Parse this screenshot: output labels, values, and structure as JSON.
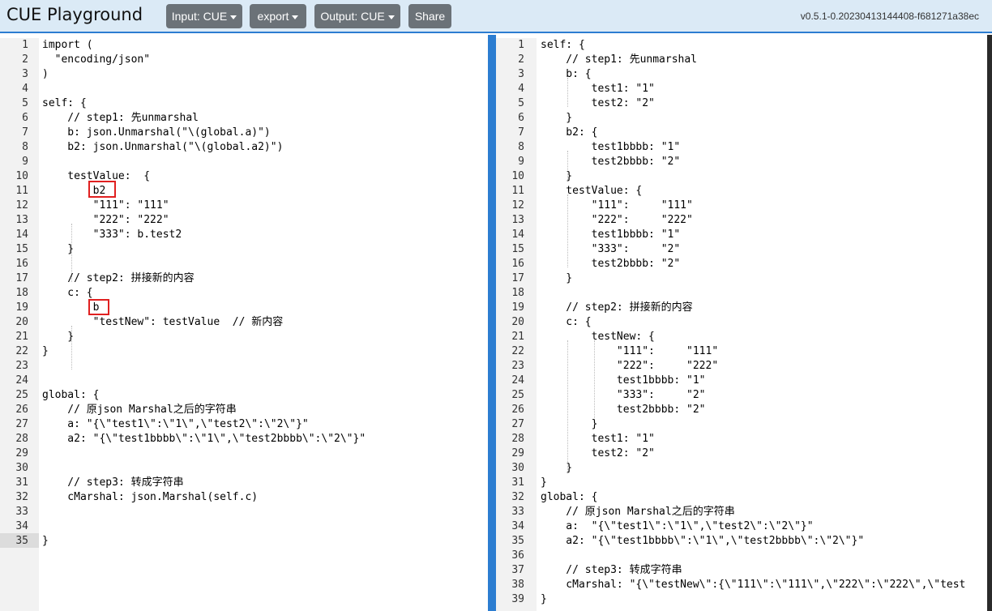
{
  "header": {
    "title": "CUE Playground",
    "input_label": "Input: CUE",
    "export_label": "export",
    "output_label": "Output: CUE",
    "share_label": "Share",
    "version": "v0.5.1-0.20230413144408-f681271a38ec"
  },
  "colors": {
    "accent": "#2c7dd1",
    "header_bg": "#dbeaf6",
    "button_bg": "#6b7278",
    "highlight_box": "#e02020"
  },
  "input": {
    "lines": [
      "import (",
      "  \"encoding/json\"",
      ")",
      "",
      "self: {",
      "    // step1: 先unmarshal",
      "    b: json.Unmarshal(\"\\(global.a)\")",
      "    b2: json.Unmarshal(\"\\(global.a2)\")",
      "",
      "    testValue:  {",
      "        b2",
      "        \"111\": \"111\"",
      "        \"222\": \"222\"",
      "        \"333\": b.test2",
      "    }",
      "",
      "    // step2: 拼接新的内容",
      "    c: {",
      "        b",
      "        \"testNew\": testValue  // 新内容",
      "    }",
      "}",
      "",
      "",
      "global: {",
      "    // 原json Marshal之后的字符串",
      "    a: \"{\\\"test1\\\":\\\"1\\\",\\\"test2\\\":\\\"2\\\"}\"",
      "    a2: \"{\\\"test1bbbb\\\":\\\"1\\\",\\\"test2bbbb\\\":\\\"2\\\"}\"",
      "",
      "",
      "    // step3: 转成字符串",
      "    cMarshal: json.Marshal(self.c)",
      "",
      "",
      "}"
    ]
  },
  "output": {
    "lines": [
      "self: {",
      "    // step1: 先unmarshal",
      "    b: {",
      "        test1: \"1\"",
      "        test2: \"2\"",
      "    }",
      "    b2: {",
      "        test1bbbb: \"1\"",
      "        test2bbbb: \"2\"",
      "    }",
      "    testValue: {",
      "        \"111\":     \"111\"",
      "        \"222\":     \"222\"",
      "        test1bbbb: \"1\"",
      "        \"333\":     \"2\"",
      "        test2bbbb: \"2\"",
      "    }",
      "",
      "    // step2: 拼接新的内容",
      "    c: {",
      "        testNew: {",
      "            \"111\":     \"111\"",
      "            \"222\":     \"222\"",
      "            test1bbbb: \"1\"",
      "            \"333\":     \"2\"",
      "            test2bbbb: \"2\"",
      "        }",
      "        test1: \"1\"",
      "        test2: \"2\"",
      "    }",
      "}",
      "global: {",
      "    // 原json Marshal之后的字符串",
      "    a:  \"{\\\"test1\\\":\\\"1\\\",\\\"test2\\\":\\\"2\\\"}\"",
      "    a2: \"{\\\"test1bbbb\\\":\\\"1\\\",\\\"test2bbbb\\\":\\\"2\\\"}\"",
      "",
      "    // step3: 转成字符串",
      "    cMarshal: \"{\\\"testNew\\\":{\\\"111\\\":\\\"111\\\",\\\"222\\\":\\\"222\\\",\\\"test",
      "}"
    ]
  }
}
